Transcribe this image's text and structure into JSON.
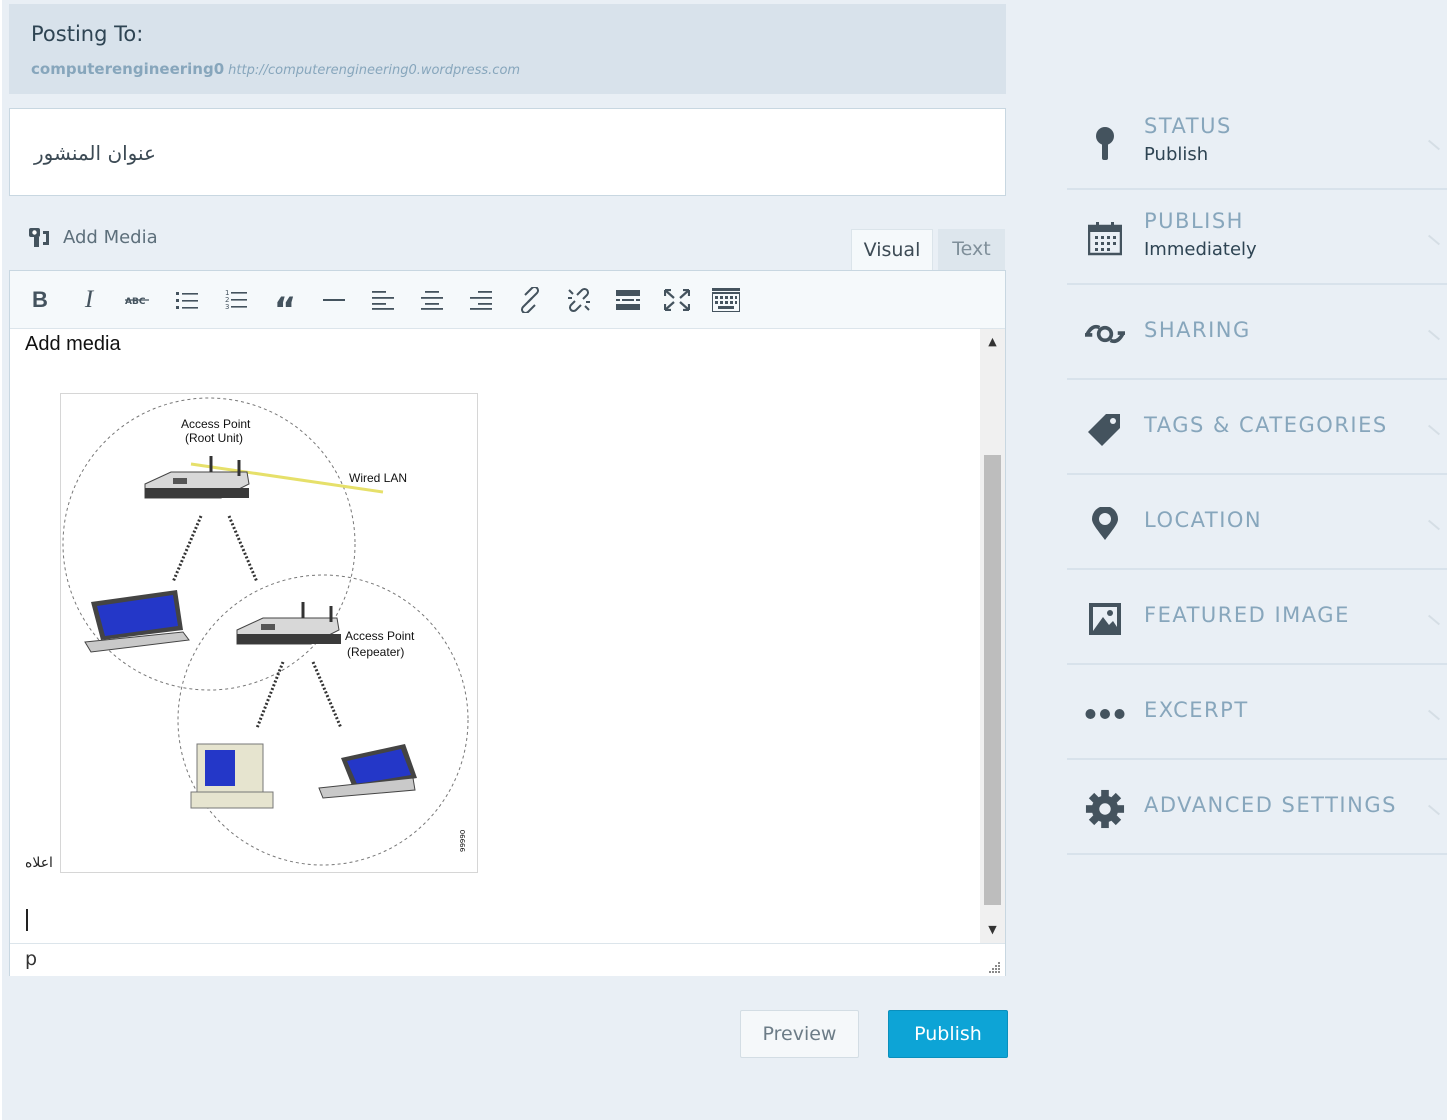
{
  "posting": {
    "label": "Posting To:",
    "site_name": "computerengineering0",
    "site_url": "http://computerengineering0.wordpress.com"
  },
  "post": {
    "title": "عنوان المنشور"
  },
  "media": {
    "add_label": "Add Media"
  },
  "tabs": {
    "visual": "Visual",
    "text": "Text"
  },
  "toolbar": {
    "buttons": [
      "bold",
      "italic",
      "strikethrough",
      "bulleted-list",
      "numbered-list",
      "blockquote",
      "horizontal-rule",
      "align-left",
      "align-center",
      "align-right",
      "insert-link",
      "remove-link",
      "read-more",
      "fullscreen",
      "toolbar-toggle"
    ]
  },
  "editor": {
    "first_line": "Add media",
    "caption": "اعلاه",
    "path": "p",
    "figure_labels": {
      "ap_root_1": "Access Point",
      "ap_root_2": "(Root Unit)",
      "wired": "Wired LAN",
      "ap_rep_1": "Access Point",
      "ap_rep_2": "(Repeater)",
      "figure_number": "99990"
    }
  },
  "actions": {
    "preview": "Preview",
    "publish": "Publish"
  },
  "sidebar": {
    "items": [
      {
        "title": "STATUS",
        "value": "Publish",
        "icon": "pin-icon"
      },
      {
        "title": "PUBLISH",
        "value": "Immediately",
        "icon": "calendar-icon"
      },
      {
        "title": "SHARING",
        "value": "",
        "icon": "sharing-icon"
      },
      {
        "title": "TAGS & CATEGORIES",
        "value": "",
        "icon": "tag-icon"
      },
      {
        "title": "LOCATION",
        "value": "",
        "icon": "location-icon"
      },
      {
        "title": "FEATURED IMAGE",
        "value": "",
        "icon": "image-icon"
      },
      {
        "title": "EXCERPT",
        "value": "",
        "icon": "ellipsis-icon"
      },
      {
        "title": "ADVANCED SETTINGS",
        "value": "",
        "icon": "gear-icon"
      }
    ]
  },
  "colors": {
    "accent": "#0da4d6",
    "sidebar_text": "#87a6bc",
    "background": "#e9eff5"
  }
}
